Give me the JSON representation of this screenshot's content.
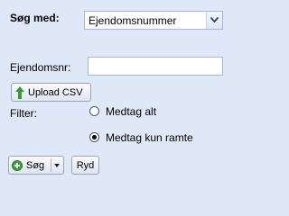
{
  "search": {
    "label": "Søg med:",
    "selected": "Ejendomsnummer"
  },
  "property_field": {
    "label": "Ejendomsnr:",
    "value": ""
  },
  "upload": {
    "label": "Upload CSV"
  },
  "filter": {
    "label": "Filter:",
    "options": [
      {
        "label": "Medtag alt",
        "checked": false
      },
      {
        "label": "Medtag kun ramte",
        "checked": true
      }
    ]
  },
  "actions": {
    "search_label": "Søg",
    "clear_label": "Ryd"
  },
  "colors": {
    "background": "#dfe8f6",
    "upload_arrow": "#3a9a2e",
    "search_icon": "#3aa23a"
  },
  "icons": {
    "select_arrow": "chevron-down-icon",
    "upload": "upload-arrow-icon",
    "search": "add-circle-icon",
    "search_menu": "caret-down-icon"
  }
}
